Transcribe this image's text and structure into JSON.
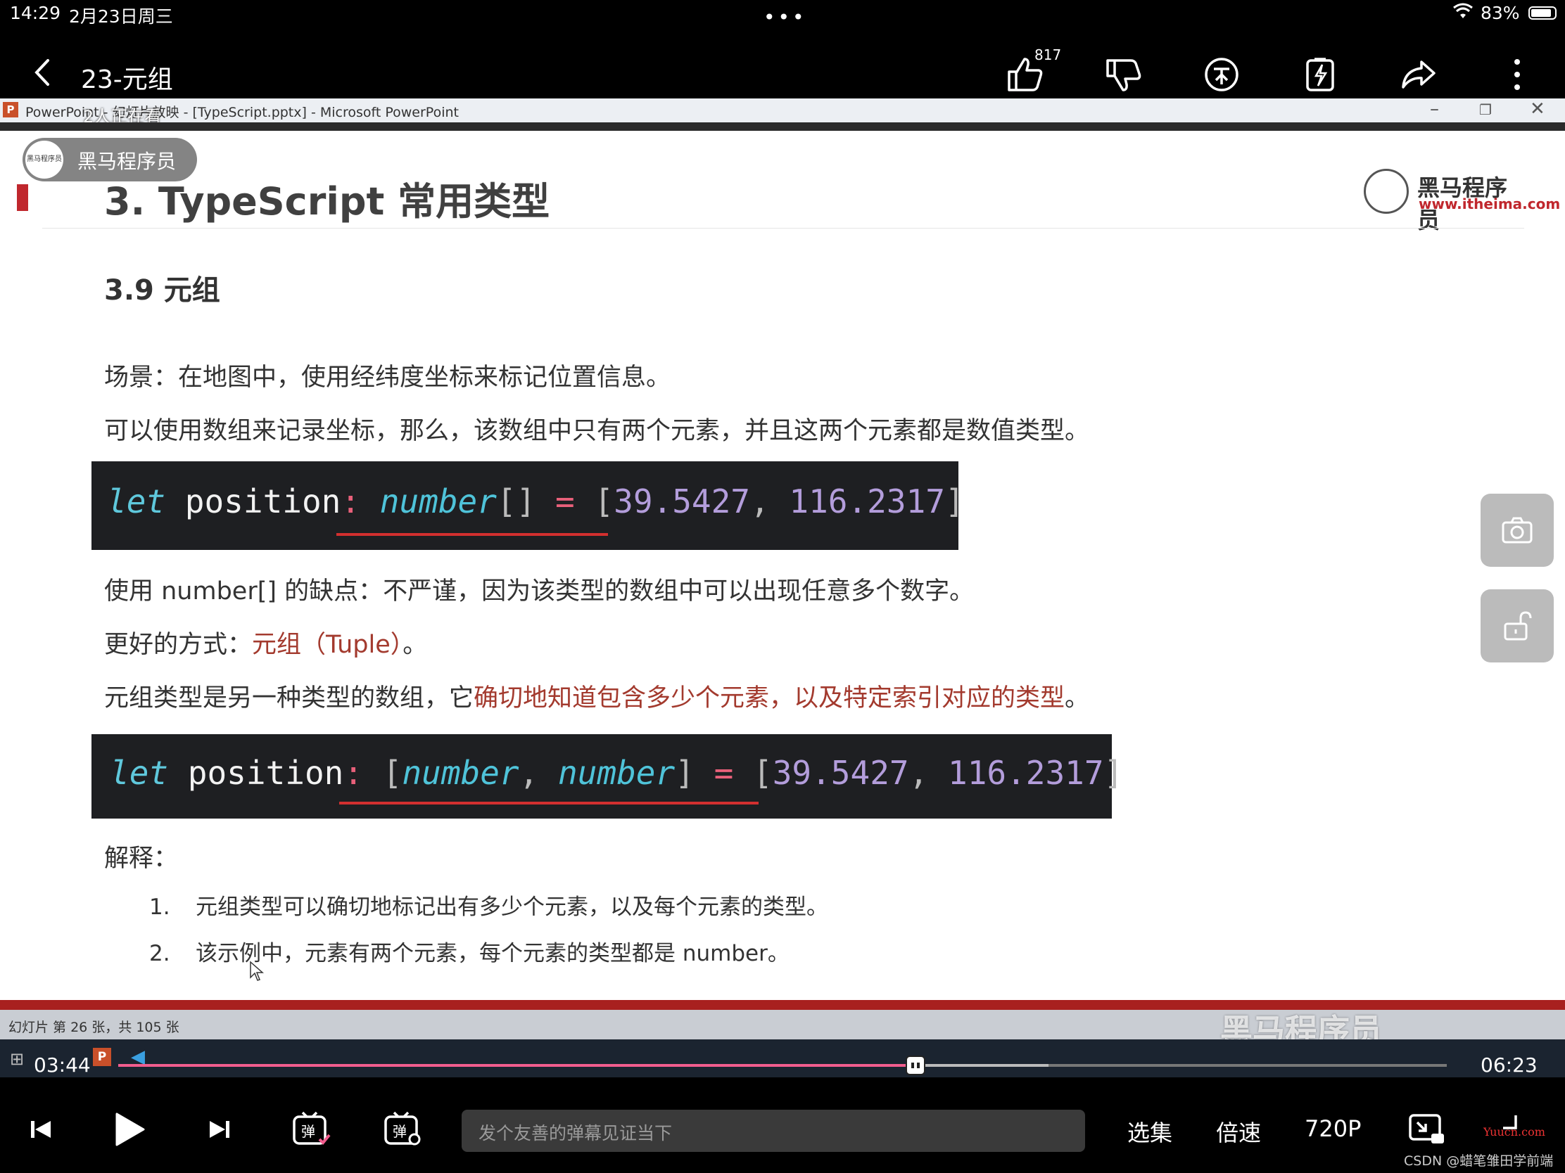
{
  "status_bar": {
    "time": "14:29",
    "date": "2月23日周三",
    "battery": "83%"
  },
  "header": {
    "title": "23-元组",
    "like_count": "817"
  },
  "powerpoint": {
    "window_title": "PowerPoint - 幻灯片放映 - [TypeScript.pptx] - Microsoft PowerPoint",
    "viewers": "2人正在看",
    "statusbar": "幻灯片 第 26 张，共 105 张"
  },
  "uploader": {
    "name": "黑马程序员",
    "avatar_text": "黑马程序员"
  },
  "slide": {
    "title": "3. TypeScript 常用类型",
    "logo_name": "黑马程序员",
    "logo_url": "www.itheima.com",
    "section": "3.9 元组",
    "p1": "场景：在地图中，使用经纬度坐标来标记位置信息。",
    "p2": "可以使用数组来记录坐标，那么，该数组中只有两个元素，并且这两个元素都是数值类型。",
    "code1": {
      "let": "let",
      "ident": " position",
      "colon": ":",
      "type": "number",
      "brackets": "[]",
      "eq": "=",
      "open": "[",
      "v1": "39.5427",
      "comma": ",",
      "v2": "116.2317",
      "close": "]"
    },
    "p3": "使用 number[] 的缺点：不严谨，因为该类型的数组中可以出现任意多个数字。",
    "p4_prefix": "更好的方式：",
    "p4_red": "元组（Tuple）",
    "p4_suffix": "。",
    "p5_prefix": "元组类型是另一种类型的数组，它",
    "p5_red": "确切地知道包含多少个元素，以及特定索引对应的类型",
    "p5_suffix": "。",
    "code2": {
      "let": "let",
      "ident": " position",
      "colon": ":",
      "open_t": "[",
      "t1": "number",
      "comma_t": ",",
      "t2": "number",
      "close_t": "]",
      "eq": "=",
      "open": "[",
      "v1": "39.5427",
      "comma": ",",
      "v2": "116.2317",
      "close": "]"
    },
    "explain_label": "解释：",
    "list": [
      {
        "num": "1.",
        "text": "元组类型可以确切地标记出有多少个元素，以及每个元素的类型。"
      },
      {
        "num": "2.",
        "text": "该示例中，元素有两个元素，每个元素的类型都是 number。"
      }
    ],
    "watermark": "黑马程序员"
  },
  "player": {
    "current_time": "03:44",
    "total_time": "06:23",
    "progress": 0.6,
    "buffered": 0.7,
    "danmaku_placeholder": "发个友善的弹幕见证当下",
    "episodes": "选集",
    "speed": "倍速",
    "quality": "720P"
  },
  "credit": "CSDN @蜡笔雏田学前端",
  "site_mark": "Yuucn.com",
  "icons": [
    "back-icon",
    "thumbs-up-icon",
    "thumbs-down-icon",
    "coin-icon",
    "favorite-icon",
    "share-icon",
    "more-icon",
    "camera-icon",
    "unlock-icon",
    "prev-icon",
    "play-icon",
    "next-icon",
    "danmaku-toggle-icon",
    "danmaku-settings-icon",
    "pip-icon",
    "fullscreen-exit-icon"
  ]
}
